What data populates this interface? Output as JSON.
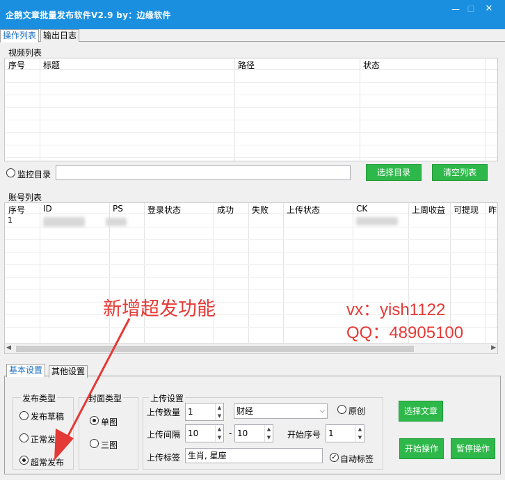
{
  "window": {
    "title": "企鹅文章批量发布软件V2.9 by：边缘软件",
    "min_glyph": "—",
    "max_glyph": "☐",
    "close_glyph": "✕"
  },
  "tabs": [
    {
      "label": "操作列表",
      "active": true
    },
    {
      "label": "输出日志",
      "active": false
    }
  ],
  "video_list": {
    "label": "视频列表",
    "columns": [
      "序号",
      "标题",
      "路径",
      "状态"
    ]
  },
  "monitor": {
    "label": "监控目录",
    "path_value": "",
    "choose_label": "选择目录",
    "clear_label": "清空列表"
  },
  "account_list": {
    "label": "账号列表",
    "columns": [
      "序号",
      "ID",
      "PS",
      "登录状态",
      "成功",
      "失败",
      "上传状态",
      "CK",
      "上周收益",
      "可提现",
      "昨"
    ],
    "rows": [
      {
        "index": "1"
      }
    ]
  },
  "annotations": {
    "feature": "新增超发功能",
    "vx": "vx：yish1122",
    "qq": "QQ：48905100"
  },
  "settings_tabs": [
    {
      "label": "基本设置",
      "active": true
    },
    {
      "label": "其他设置",
      "active": false
    }
  ],
  "publish_type": {
    "title": "发布类型",
    "options": [
      {
        "label": "发布草稿",
        "checked": false
      },
      {
        "label": "正常发布",
        "checked": false
      },
      {
        "label": "超常发布",
        "checked": true
      }
    ]
  },
  "cover_type": {
    "title": "封面类型",
    "options": [
      {
        "label": "单图",
        "checked": true
      },
      {
        "label": "三图",
        "checked": false
      }
    ]
  },
  "upload": {
    "title": "上传设置",
    "count_label": "上传数量",
    "count_value": "1",
    "category_value": "财经",
    "original_label": "原创",
    "interval_label": "上传间隔",
    "interval_from": "10",
    "interval_sep": "-",
    "interval_to": "10",
    "start_label": "开始序号",
    "start_value": "1",
    "tags_label": "上传标签",
    "tags_value": "生肖, 星座",
    "auto_tag_label": "自动标签",
    "auto_tag_checked": true
  },
  "actions": {
    "choose_article": "选择文章",
    "start": "开始操作",
    "pause": "暂停操作"
  },
  "colors": {
    "titlebar": "#1a8fe0",
    "button_green": "#2eb84a",
    "annotation_red": "#e53935"
  }
}
